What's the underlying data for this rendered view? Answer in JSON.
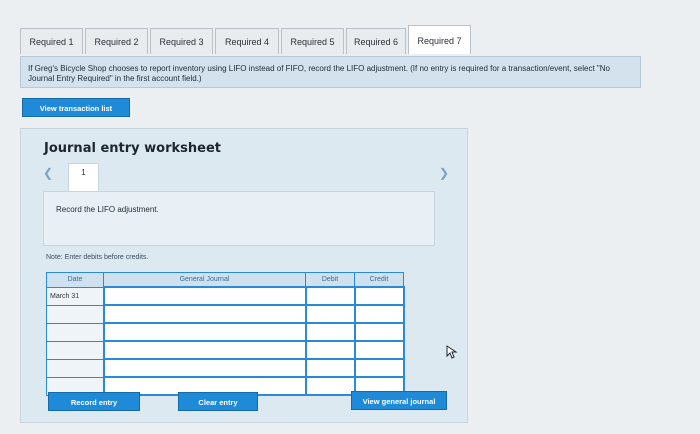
{
  "tabs": [
    {
      "label": "Required 1",
      "active": false
    },
    {
      "label": "Required 2",
      "active": false
    },
    {
      "label": "Required 3",
      "active": false
    },
    {
      "label": "Required 4",
      "active": false
    },
    {
      "label": "Required 5",
      "active": false
    },
    {
      "label": "Required 6",
      "active": false
    },
    {
      "label": "Required 7",
      "active": true
    }
  ],
  "instruction": "If Greg's Bicycle Shop chooses to report inventory using LIFO instead of FIFO, record the LIFO adjustment. (If no entry is required for a transaction/event, select \"No Journal Entry Required\" in the first account field.)",
  "buttons": {
    "view_transaction_list": "View transaction list",
    "record_entry": "Record entry",
    "clear_entry": "Clear entry",
    "view_general_journal": "View general journal"
  },
  "worksheet": {
    "title": "Journal entry worksheet",
    "page_number": "1",
    "task": "Record the LIFO adjustment.",
    "note": "Note: Enter debits before credits.",
    "columns": {
      "date": "Date",
      "general_journal": "General Journal",
      "debit": "Debit",
      "credit": "Credit"
    },
    "rows": [
      {
        "date": "March 31",
        "account": "",
        "debit": "",
        "credit": ""
      },
      {
        "date": "",
        "account": "",
        "debit": "",
        "credit": ""
      },
      {
        "date": "",
        "account": "",
        "debit": "",
        "credit": ""
      },
      {
        "date": "",
        "account": "",
        "debit": "",
        "credit": ""
      },
      {
        "date": "",
        "account": "",
        "debit": "",
        "credit": ""
      },
      {
        "date": "",
        "account": "",
        "debit": "",
        "credit": ""
      }
    ]
  },
  "colors": {
    "accent": "#1f8bd8",
    "instruction_bg": "#d3e2ec",
    "worksheet_bg": "#dde9f1"
  },
  "icons": {
    "prev": "chevron-left-icon",
    "next": "chevron-right-icon",
    "cursor": "mouse-pointer-icon"
  }
}
